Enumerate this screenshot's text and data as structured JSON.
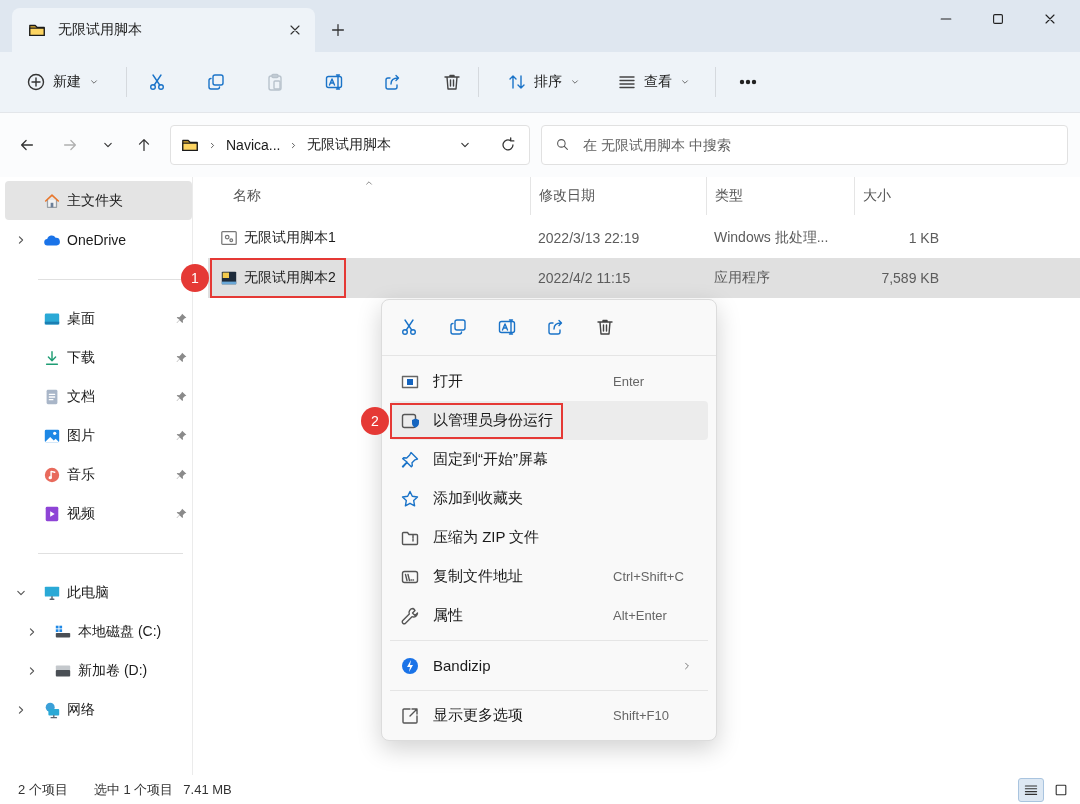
{
  "window": {
    "tab_title": "无限试用脚本"
  },
  "toolbar": {
    "new_label": "新建",
    "icon_buttons": [
      {
        "disabled": false
      },
      {
        "disabled": false
      },
      {
        "disabled": true
      },
      {
        "disabled": false
      },
      {
        "disabled": false
      },
      {
        "disabled": false
      }
    ],
    "sort_label": "排序",
    "view_label": "查看"
  },
  "navigation": {
    "back_disabled": false,
    "forward_disabled": true
  },
  "address": {
    "crumbs": [
      "Navica...",
      "无限试用脚本"
    ]
  },
  "search": {
    "placeholder": "在 无限试用脚本 中搜索"
  },
  "sidebar": {
    "groups": [
      {
        "items": [
          {
            "label": "主文件夹",
            "selected": true,
            "pinned": false
          },
          {
            "label": "OneDrive",
            "selected": false,
            "pinned": false,
            "expanded": false
          }
        ]
      },
      {
        "items": [
          {
            "label": "桌面",
            "selected": false,
            "pinned": true
          },
          {
            "label": "下载",
            "selected": false,
            "pinned": true
          },
          {
            "label": "文档",
            "selected": false,
            "pinned": true
          },
          {
            "label": "图片",
            "selected": false,
            "pinned": true
          },
          {
            "label": "音乐",
            "selected": false,
            "pinned": true
          },
          {
            "label": "视频",
            "selected": false,
            "pinned": true
          }
        ]
      },
      {
        "items": [
          {
            "label": "此电脑",
            "selected": false,
            "pinned": false,
            "expanded": true,
            "children": [
              {
                "label": "本地磁盘 (C:)",
                "selected": false,
                "pinned": false,
                "expanded": false
              },
              {
                "label": "新加卷 (D:)",
                "selected": false,
                "pinned": false,
                "expanded": false
              }
            ]
          },
          {
            "label": "网络",
            "selected": false,
            "pinned": false,
            "expanded": false
          }
        ]
      }
    ]
  },
  "table": {
    "columns": [
      {
        "label": "名称",
        "sorted": true
      },
      {
        "label": "修改日期",
        "sorted": false
      },
      {
        "label": "类型",
        "sorted": false
      },
      {
        "label": "大小",
        "sorted": false
      }
    ],
    "rows": [
      {
        "kind": "script",
        "name": "无限试用脚本1",
        "date": "2022/3/13 22:19",
        "type": "Windows 批处理...",
        "size": "1 KB",
        "selected": false
      },
      {
        "kind": "app",
        "name": "无限试用脚本2",
        "date": "2022/4/2 11:15",
        "type": "应用程序",
        "size": "7,589 KB",
        "selected": true,
        "callout": "1"
      }
    ]
  },
  "context_menu": {
    "quick_actions": [
      {
        "disabled": false
      },
      {
        "disabled": false
      },
      {
        "disabled": false
      },
      {
        "disabled": false
      },
      {
        "disabled": false
      }
    ],
    "groups": [
      {
        "items": [
          {
            "label": "打开",
            "shortcut": "Enter",
            "highlighted": false
          },
          {
            "label": "以管理员身份运行",
            "highlighted": true,
            "callout": "2"
          },
          {
            "label": "固定到“开始”屏幕",
            "highlighted": false
          },
          {
            "label": "添加到收藏夹",
            "highlighted": false
          },
          {
            "label": "压缩为 ZIP 文件",
            "highlighted": false
          },
          {
            "label": "复制文件地址",
            "shortcut": "Ctrl+Shift+C",
            "highlighted": false
          },
          {
            "label": "属性",
            "shortcut": "Alt+Enter",
            "highlighted": false
          }
        ]
      },
      {
        "items": [
          {
            "label": "Bandizip",
            "highlighted": false,
            "submenu": true
          }
        ]
      },
      {
        "items": [
          {
            "label": "显示更多选项",
            "shortcut": "Shift+F10",
            "highlighted": false
          }
        ]
      }
    ]
  },
  "status_bar": {
    "item_count": "2 个项目",
    "selection": "选中 1 个项目",
    "selection_size": "7.41 MB",
    "views": [
      {
        "selected": true
      },
      {
        "selected": false
      }
    ]
  }
}
